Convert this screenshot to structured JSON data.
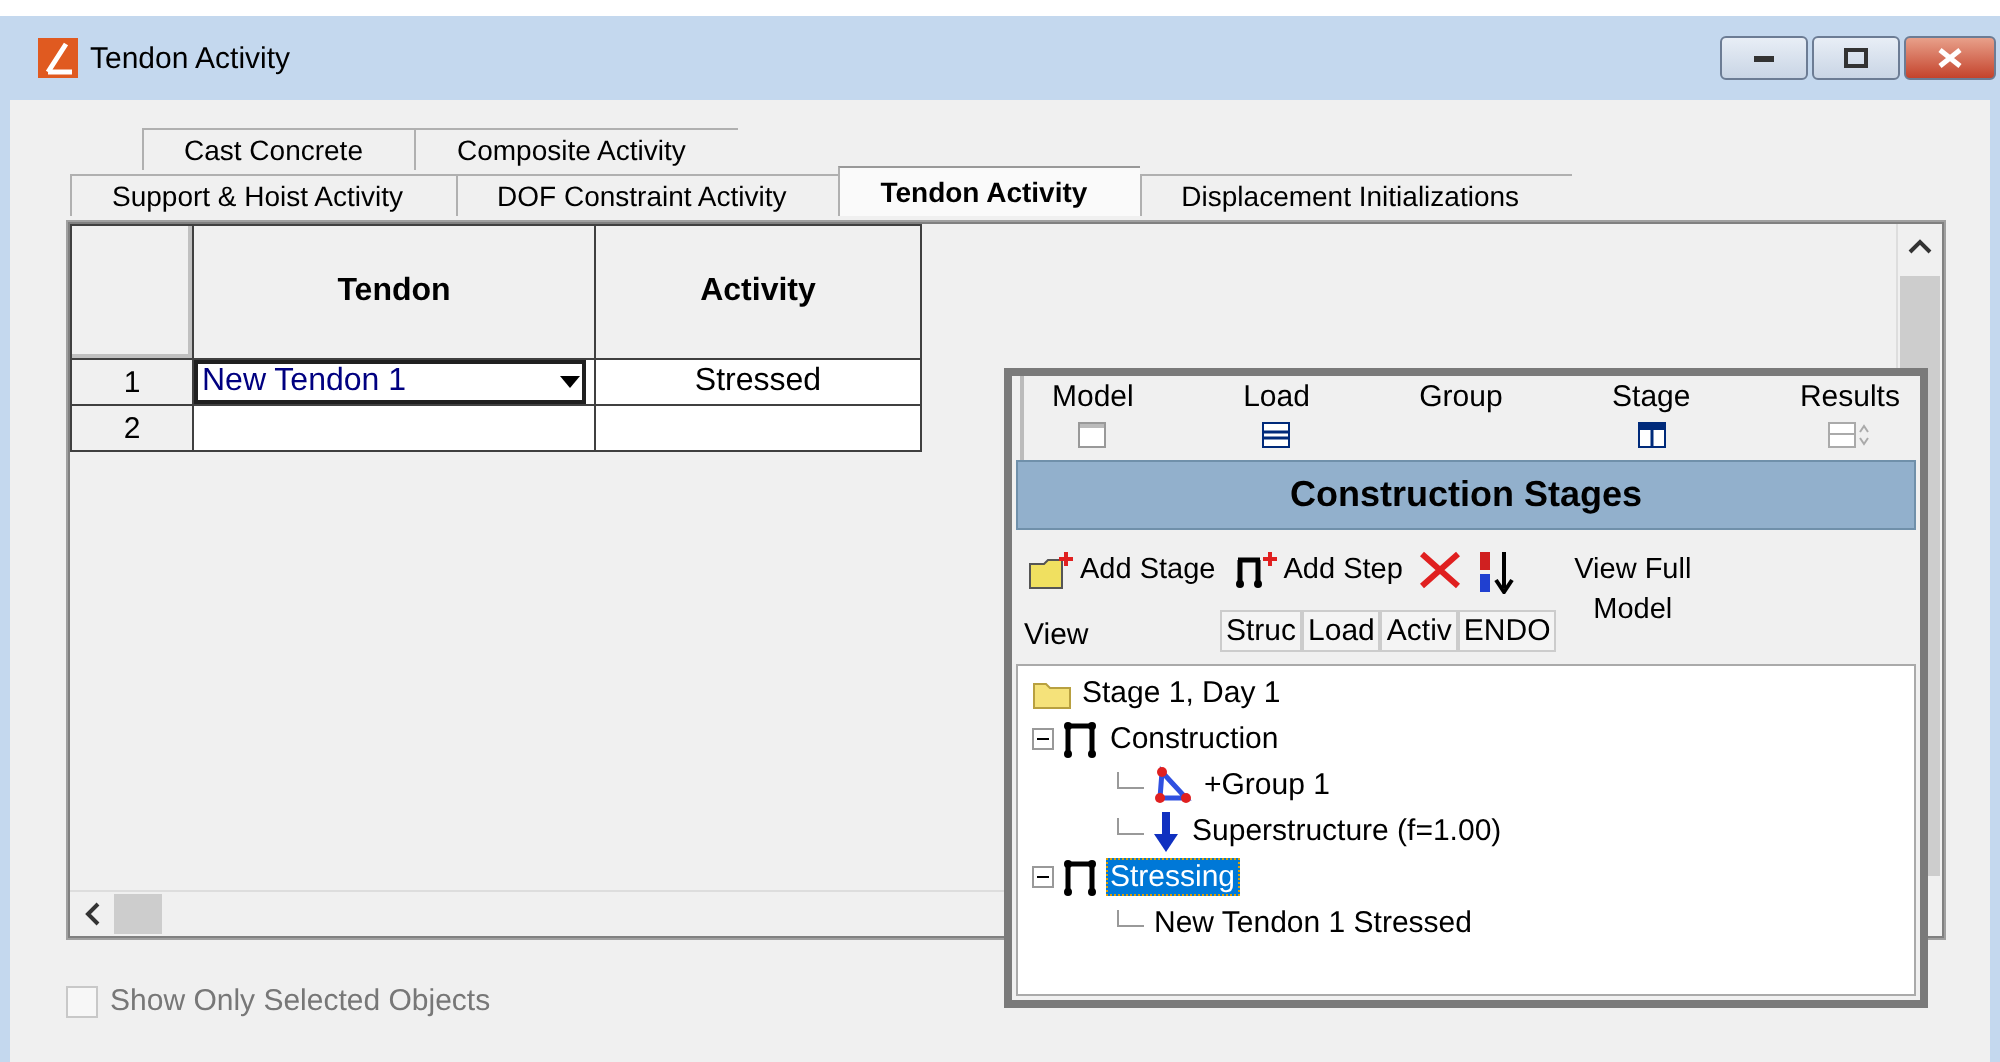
{
  "window": {
    "title": "Tendon Activity"
  },
  "tab_rows": [
    {
      "tabs": [
        {
          "label": "Cast Concrete",
          "selected": false
        },
        {
          "label": "Composite Activity",
          "selected": false
        }
      ]
    },
    {
      "tabs": [
        {
          "label": "Support & Hoist Activity",
          "selected": false
        },
        {
          "label": "DOF Constraint Activity",
          "selected": false
        },
        {
          "label": "Tendon Activity",
          "selected": true
        },
        {
          "label": "Displacement Initializations",
          "selected": false
        }
      ]
    }
  ],
  "grid": {
    "columns": [
      "Tendon",
      "Activity"
    ],
    "rows": [
      {
        "number": "1",
        "tendon": "New Tendon 1",
        "activity": "Stressed"
      },
      {
        "number": "2"
      }
    ]
  },
  "show_only_selected": {
    "label": "Show Only Selected Objects",
    "checked": false,
    "disabled": true
  },
  "stages_panel": {
    "toolbar": [
      {
        "label": "Model",
        "kind": "model"
      },
      {
        "label": "Load",
        "kind": "load"
      },
      {
        "label": "Group",
        "kind": "group"
      },
      {
        "label": "Stage",
        "kind": "stage"
      },
      {
        "label": "Results",
        "kind": "results"
      }
    ],
    "title": "Construction Stages",
    "actions": [
      {
        "label": "Add Stage",
        "kind": "add-stage"
      },
      {
        "label": "Add Step",
        "kind": "add-step"
      },
      {
        "kind": "delete"
      },
      {
        "kind": "sort"
      }
    ],
    "view_full": "View Full Model",
    "view_label": "View",
    "view_buttons": [
      "Struc",
      "Load",
      "Activ",
      "ENDO"
    ],
    "tree": [
      {
        "label": "Stage 1, Day 1",
        "kind": "stage",
        "selected": false,
        "children": [
          {
            "label": "Construction",
            "kind": "step",
            "selected": false,
            "expanded": true,
            "children": [
              {
                "label": "+Group 1",
                "kind": "group",
                "selected": false
              },
              {
                "label": "Superstructure (f=1.00)",
                "kind": "load",
                "selected": false
              }
            ]
          },
          {
            "label": "Stressing",
            "kind": "step",
            "selected": true,
            "expanded": true,
            "children": [
              {
                "label": "New Tendon 1 Stressed",
                "kind": "tendon",
                "selected": false
              }
            ]
          }
        ]
      }
    ]
  }
}
